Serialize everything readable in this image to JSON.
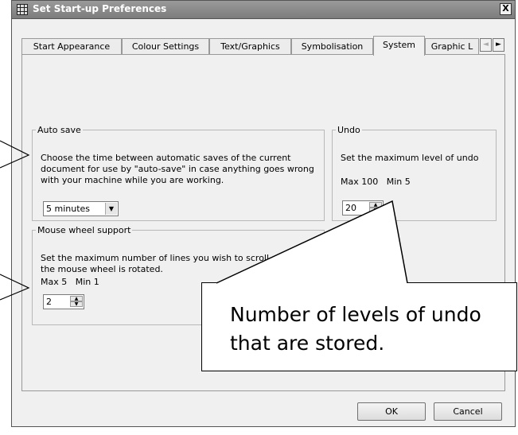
{
  "window": {
    "title": "Set Start-up Preferences",
    "close_label": "X"
  },
  "tabs": [
    {
      "label": "Start Appearance",
      "active": false
    },
    {
      "label": "Colour Settings",
      "active": false
    },
    {
      "label": "Text/Graphics",
      "active": false
    },
    {
      "label": "Symbolisation",
      "active": false
    },
    {
      "label": "System",
      "active": true
    },
    {
      "label": "Graphic L",
      "active": false
    }
  ],
  "tab_scroll": {
    "left": "◄",
    "right": "►"
  },
  "autosave": {
    "legend": "Auto save",
    "description": "Choose the time between automatic saves of the current document for use by \"auto-save\" in case anything goes wrong with your machine while you are working.",
    "selected": "5 minutes"
  },
  "undo": {
    "legend": "Undo",
    "description": "Set the maximum level of undo",
    "limits": "Max 100   Min 5",
    "value": "20"
  },
  "mousewheel": {
    "legend": "Mouse wheel support",
    "description": "Set the maximum number of lines you wish to scroll each time the mouse wheel is rotated.",
    "limits": "Max 5   Min 1",
    "value": "2"
  },
  "buttons": {
    "ok": "OK",
    "cancel": "Cancel"
  },
  "callout": {
    "text": "Number of levels of undo that are stored."
  }
}
